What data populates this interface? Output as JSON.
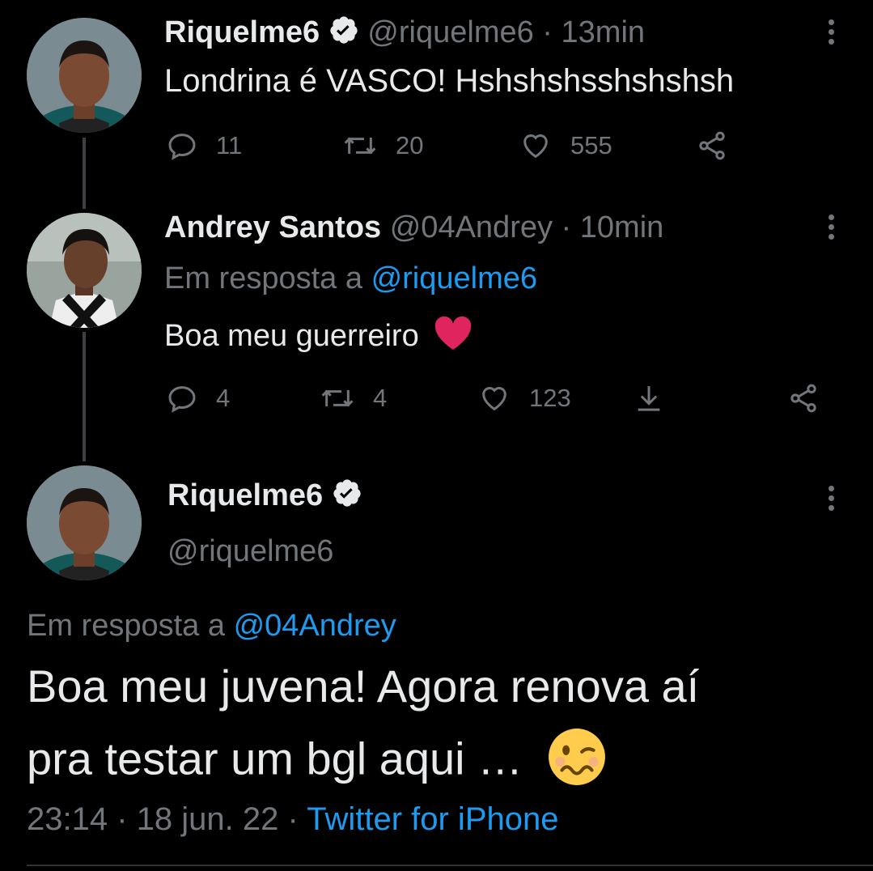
{
  "tweets": [
    {
      "display_name": "Riquelme6",
      "handle": "@riquelme6",
      "sep": "·",
      "time": "13min",
      "text": "Londrina é VASCO! Hshshshsshshshsh",
      "actions": {
        "replies": "11",
        "retweets": "20",
        "likes": "555"
      }
    },
    {
      "display_name": "Andrey Santos",
      "handle": "@04Andrey",
      "sep": "·",
      "time": "10min",
      "reply_prefix": "Em resposta a",
      "reply_to": "@riquelme6",
      "text": "Boa meu guerreiro",
      "emoji": "heart",
      "actions": {
        "replies": "4",
        "retweets": "4",
        "likes": "123"
      }
    }
  ],
  "main_tweet": {
    "display_name": "Riquelme6",
    "handle": "@riquelme6",
    "reply_prefix": "Em resposta a",
    "reply_to": "@04Andrey",
    "text_line1": "Boa meu juvena! Agora renova aí",
    "text_line2": "pra testar um bgl aqui …",
    "emoji": "woozy-face",
    "time": "23:14",
    "sep1": "·",
    "date": "18 jun. 22",
    "sep2": "·",
    "source": "Twitter for iPhone"
  },
  "colors": {
    "background": "#000000",
    "link": "#1d9bf0",
    "muted": "#71767b",
    "verified": "#e7e9ea",
    "heart": "#e0245e"
  }
}
